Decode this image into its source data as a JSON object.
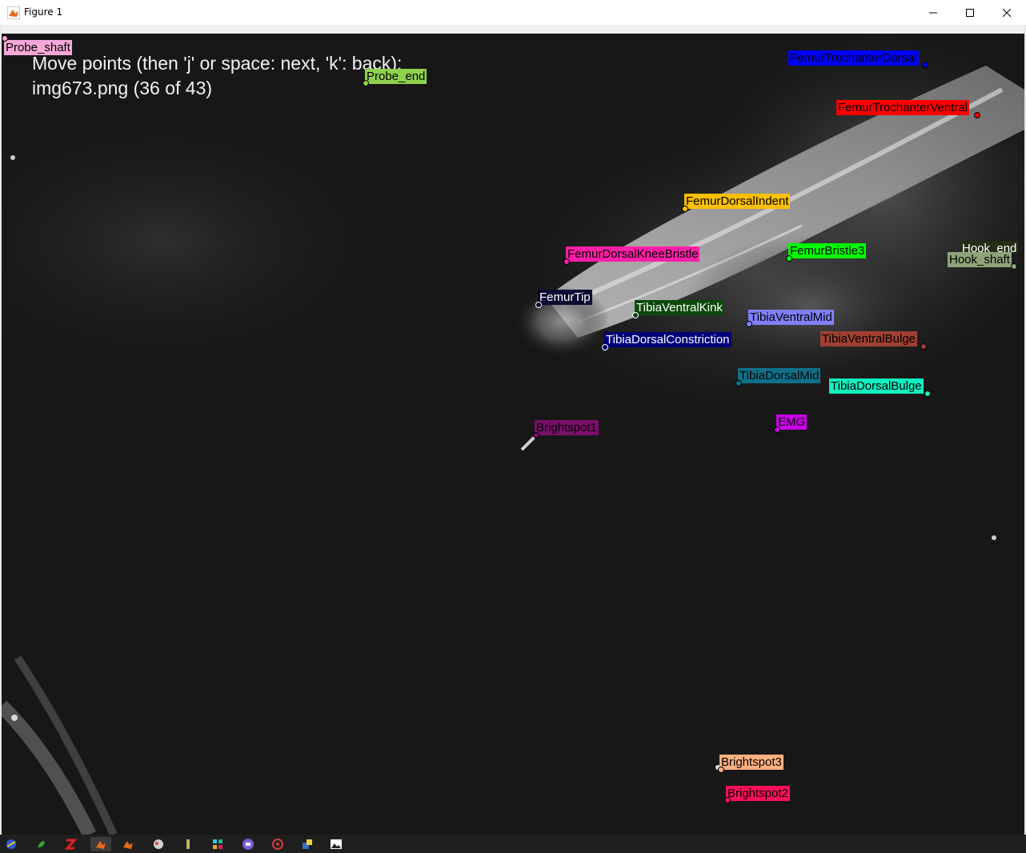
{
  "window": {
    "title": "Figure 1",
    "minimize_symbol": "—",
    "maximize_symbol": "☐",
    "close_symbol": "✕"
  },
  "figure": {
    "instruction_line1": "Move points (then 'j' or space: next, 'k': back):",
    "instruction_line2": "img673.png (36 of 43)"
  },
  "labels": [
    {
      "text": "Probe_shaft",
      "bg": "#f7a8d8",
      "fg": "#000000"
    },
    {
      "text": "Probe_end",
      "bg": "#8fd14f",
      "fg": "#000000"
    },
    {
      "text": "FemurTrochanterDorsal",
      "bg": "#0000ff",
      "fg": "#000000"
    },
    {
      "text": "FemurTrochanterVentral",
      "bg": "#ff0000",
      "fg": "#000000"
    },
    {
      "text": "FemurDorsalIndent",
      "bg": "#ffc000",
      "fg": "#000000"
    },
    {
      "text": "FemurDorsalKneeBristle",
      "bg": "#ff1fa6",
      "fg": "#000000"
    },
    {
      "text": "FemurBristle3",
      "bg": "#00ff00",
      "fg": "#000000"
    },
    {
      "text": "Hook_end",
      "bg": "#262e16",
      "fg": "#ffffff"
    },
    {
      "text": "Hook_shaft",
      "bg": "#8fa47a",
      "fg": "#000000"
    },
    {
      "text": "FemurTip",
      "bg": "#0a0a32",
      "fg": "#ffffff"
    },
    {
      "text": "TibiaVentralKink",
      "bg": "#0b4a0b",
      "fg": "#ffffff"
    },
    {
      "text": "TibiaVentralMid",
      "bg": "#8080ff",
      "fg": "#000000"
    },
    {
      "text": "TibiaDorsalConstriction",
      "bg": "#00007a",
      "fg": "#ffffff"
    },
    {
      "text": "TibiaVentralBulge",
      "bg": "#a04030",
      "fg": "#000000"
    },
    {
      "text": "TibiaDorsalMid",
      "bg": "#10708a",
      "fg": "#000000"
    },
    {
      "text": "TibiaDorsalBulge",
      "bg": "#10f0c0",
      "fg": "#000000"
    },
    {
      "text": "Brightspot1",
      "bg": "#7a0e6a",
      "fg": "#000000"
    },
    {
      "text": "EMG",
      "bg": "#c800e6",
      "fg": "#000000"
    },
    {
      "text": "Brightspot3",
      "bg": "#ffb080",
      "fg": "#000000"
    },
    {
      "text": "Brightspot2",
      "bg": "#ff0e5a",
      "fg": "#000000"
    }
  ],
  "taskbar": {
    "icons": [
      "app-1-icon",
      "app-2-icon",
      "app-3-icon",
      "matlab-icon",
      "matlab-2-icon",
      "app-6-icon",
      "app-7-icon",
      "app-8-icon",
      "app-9-icon",
      "app-10-icon",
      "app-11-icon",
      "image-viewer-icon"
    ]
  }
}
